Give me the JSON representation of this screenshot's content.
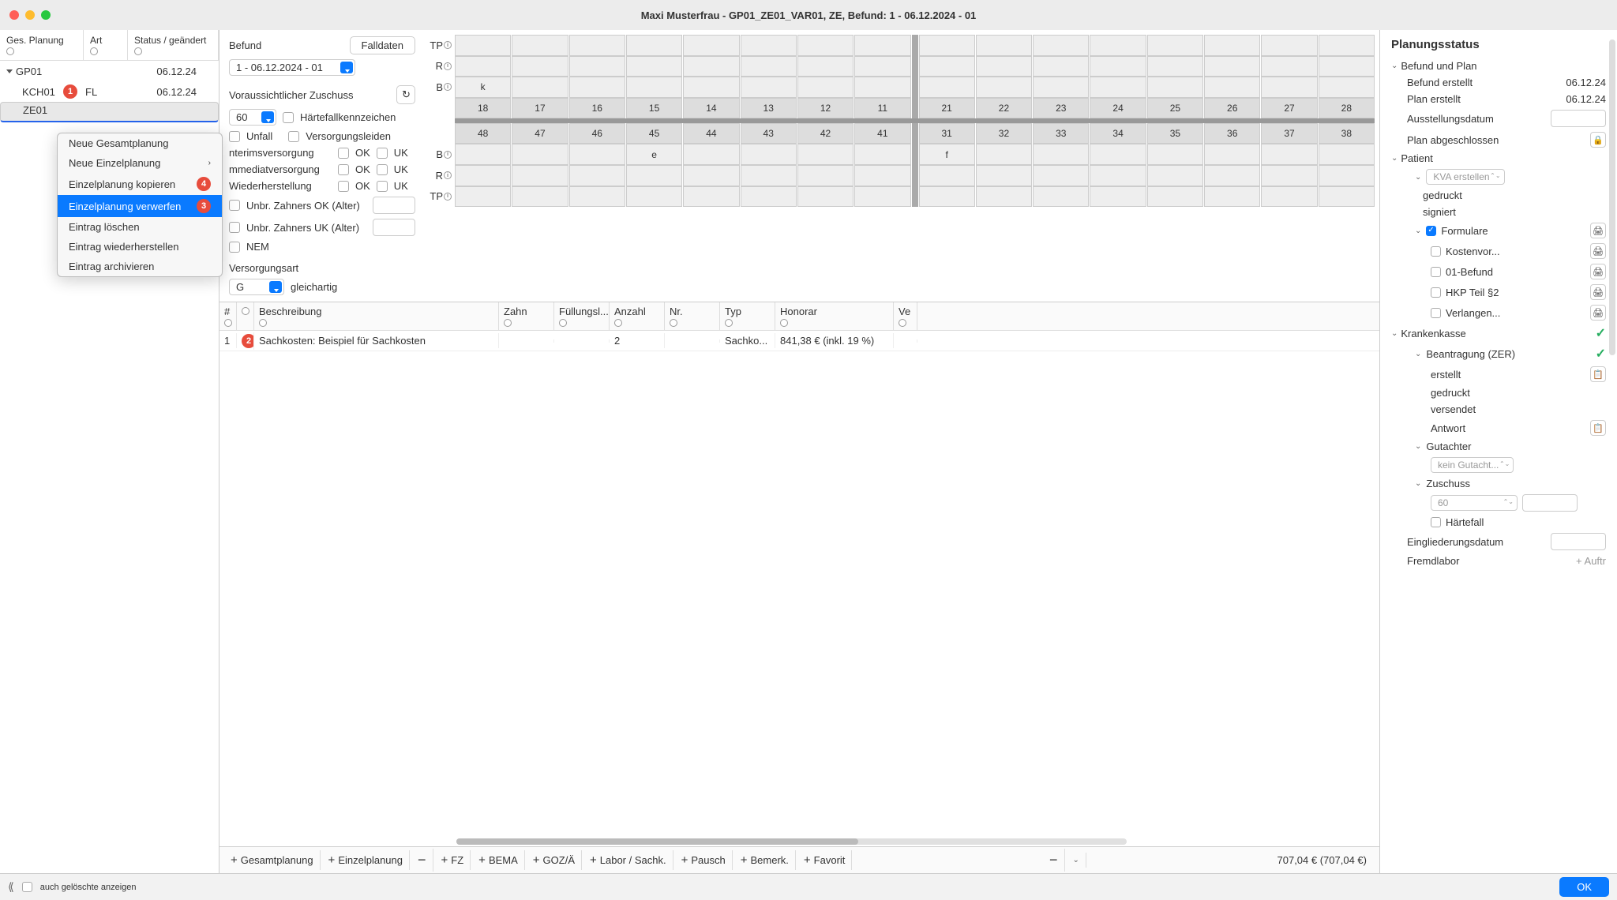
{
  "window_title": "Maxi Musterfrau  -  GP01_ZE01_VAR01, ZE, Befund: 1 - 06.12.2024 - 01",
  "left": {
    "headers": [
      "Ges. Planung",
      "Art",
      "Status / geändert"
    ],
    "rows": [
      {
        "name": "GP01",
        "art": "",
        "date": "06.12.24",
        "indent": 0,
        "caret": true
      },
      {
        "name": "KCH01",
        "badge": "1",
        "art": "FL",
        "date": "06.12.24",
        "indent": 1
      },
      {
        "name": "ZE01",
        "art": "",
        "date": "",
        "indent": 1,
        "sel": true
      }
    ]
  },
  "ctx": {
    "items": [
      {
        "label": "Neue Gesamtplanung"
      },
      {
        "label": "Neue Einzelplanung",
        "sub": true
      },
      {
        "label": "Einzelplanung kopieren",
        "badge": "4"
      },
      {
        "label": "Einzelplanung verwerfen",
        "badge": "3",
        "hl": true
      },
      {
        "label": "Eintrag löschen"
      },
      {
        "label": "Eintrag wiederherstellen",
        "dis": true
      },
      {
        "label": "Eintrag archivieren"
      }
    ]
  },
  "form": {
    "befund_label": "Befund",
    "falldaten": "Falldaten",
    "befund_val": "1 - 06.12.2024 - 01",
    "zuschuss_label": "Voraussichtlicher Zuschuss",
    "zuschuss_val": "60",
    "haerte": "Härtefallkennzeichen",
    "unfall": "Unfall",
    "versorg": "Versorgungsleiden",
    "interim": "nterimsversorgung",
    "ok": "OK",
    "uk": "UK",
    "immed": "mmediatversorgung",
    "wieder": "Wiederherstellung",
    "unbr_ok": "Unbr. Zahners OK (Alter)",
    "unbr_uk": "Unbr. Zahners UK (Alter)",
    "nem": "NEM",
    "versart_lbl": "Versorgungsart",
    "versart": "G",
    "versart_txt": "gleichartig"
  },
  "chart": {
    "row_labels": [
      "TP",
      "R",
      "B",
      "",
      "",
      "B",
      "R",
      "TP"
    ],
    "b_letter_top": "k",
    "teeth_top": [
      "18",
      "17",
      "16",
      "15",
      "14",
      "13",
      "12",
      "11",
      "21",
      "22",
      "23",
      "24",
      "25",
      "26",
      "27",
      "28"
    ],
    "teeth_bot": [
      "48",
      "47",
      "46",
      "45",
      "44",
      "43",
      "42",
      "41",
      "31",
      "32",
      "33",
      "34",
      "35",
      "36",
      "37",
      "38"
    ],
    "b_val_top": "e",
    "b_val_bot": "f"
  },
  "table": {
    "cols": [
      "#",
      "",
      "Beschreibung",
      "Zahn",
      "Füllungsl...",
      "Anzahl",
      "Nr.",
      "Typ",
      "Honorar",
      "Ve"
    ],
    "row": {
      "num": "1",
      "badge": "2",
      "desc": "Sachkosten: Beispiel für Sachkosten",
      "zahn": "",
      "fuell": "",
      "anzahl": "2",
      "nr": "",
      "typ": "Sachko...",
      "honorar": "841,38 € (inkl. 19 %)",
      "ve": ""
    }
  },
  "footer": {
    "buttons": [
      "Gesamtplanung",
      "Einzelplanung",
      "FZ",
      "BEMA",
      "GOZ/Ä",
      "Labor / Sachk.",
      "Pausch",
      "Bemerk.",
      "Favorit"
    ],
    "total": "707,04 € (707,04 €)"
  },
  "right": {
    "title": "Planungsstatus",
    "befund_plan": "Befund und Plan",
    "befund_erst": "Befund erstellt",
    "befund_erst_v": "06.12.24",
    "plan_erst": "Plan erstellt",
    "plan_erst_v": "06.12.24",
    "ausst": "Ausstellungsdatum",
    "plan_abg": "Plan abgeschlossen",
    "patient": "Patient",
    "kva": "KVA erstellen",
    "gedruckt": "gedruckt",
    "signiert": "signiert",
    "formulare": "Formulare",
    "kosten": "Kostenvor...",
    "befund01": "01-Befund",
    "hkp": "HKP Teil §2",
    "verlang": "Verlangen...",
    "kk": "Krankenkasse",
    "beantrag": "Beantragung (ZER)",
    "erstellt": "erstellt",
    "versendet": "versendet",
    "antwort": "Antwort",
    "gutachter": "Gutachter",
    "kein_gut": "kein Gutacht...",
    "zuschuss": "Zuschuss",
    "zuschuss_v": "60",
    "haertefall": "Härtefall",
    "eingl": "Eingliederungsdatum",
    "fremd": "Fremdlabor",
    "auftr": "+ Auftr"
  },
  "bottom": {
    "deleted": "auch gelöschte anzeigen",
    "ok": "OK"
  }
}
